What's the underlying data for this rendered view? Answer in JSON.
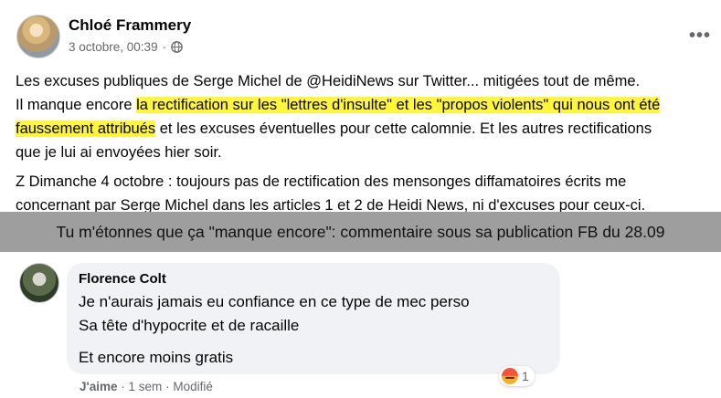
{
  "post": {
    "author": "Chloé Frammery",
    "timestamp": "3 octobre, 00:39",
    "separator": "·",
    "more": "•••",
    "line1": "Les excuses publiques de Serge Michel de @HeidiNews sur Twitter... mitigées tout de même.",
    "line2_pre": "Il manque encore ",
    "line2_hl1": "la rectification sur les \"lettres d'insulte\" et les \"propos violents\" qui nous ont été",
    "line3_hl": "faussement attribués",
    "line3_post": " et les excuses éventuelles pour cette calomnie. Et les autres rectifications",
    "line4": "que je lui ai envoyées hier soir.",
    "update_line1": "Z Dimanche 4 octobre : toujours pas de rectification des mensonges diffamatoires écrits me",
    "update_line2": "concernant par Serge Michel dans les articles 1 et 2 de Heidi News, ni d'excuses pour ceux-ci."
  },
  "banner": {
    "text": "Tu m'étonnes que ça \"manque encore\": commentaire sous sa publication FB du 28.09"
  },
  "comment": {
    "author": "Florence Colt",
    "line1": "Je n'aurais jamais eu confiance en ce type de mec perso",
    "line2": "Sa tête d'hypocrite et de racaille",
    "line3": "Et encore moins gratis",
    "reaction_count": "1",
    "like": "J'aime",
    "time": "1 sem",
    "edited": "Modifié",
    "sep": "·"
  },
  "colors": {
    "highlight": "#fff53a",
    "banner_bg": "#9e9e9e",
    "bubble_bg": "#f0f2f5",
    "meta_text": "#65676b"
  },
  "icons": {
    "privacy": "globe-icon",
    "reaction": "angry-reaction-icon",
    "menu": "more-options-icon"
  }
}
